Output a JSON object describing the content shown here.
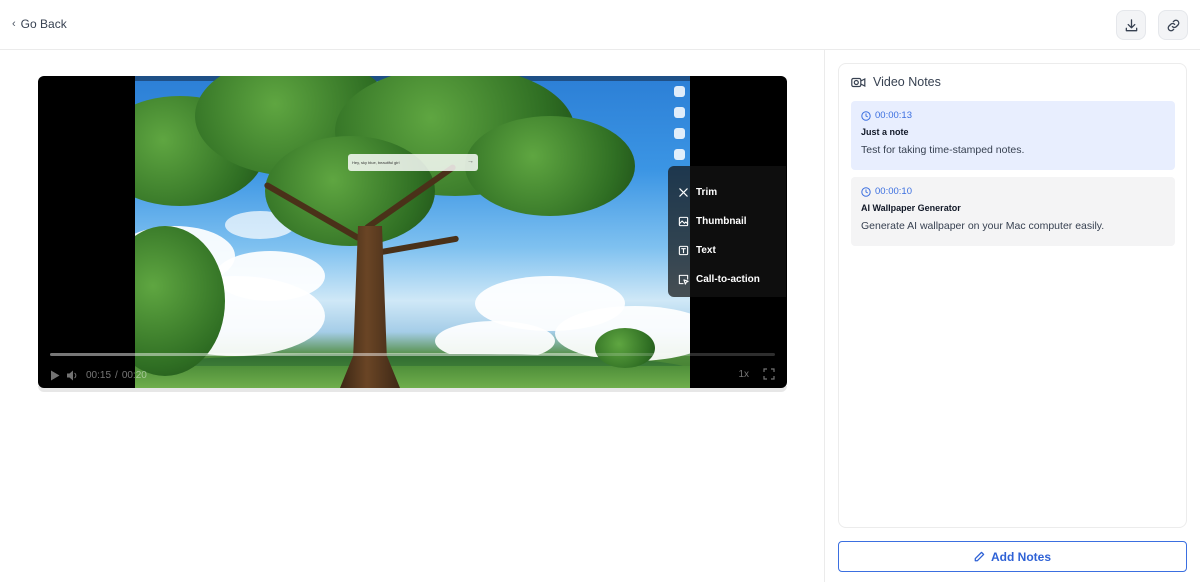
{
  "header": {
    "back_label": "Go Back",
    "back_icon": "chevron-left-icon",
    "download_icon": "download-icon",
    "link_icon": "link-icon"
  },
  "player": {
    "prompt_text": "Hey, sky blue, beautiful girl",
    "tools": [
      {
        "label": "Trim",
        "icon": "scissors-icon"
      },
      {
        "label": "Thumbnail",
        "icon": "image-icon"
      },
      {
        "label": "Text",
        "icon": "text-icon"
      },
      {
        "label": "Call-to-action",
        "icon": "cursor-icon"
      }
    ],
    "current_time": "00:15",
    "separator": "/",
    "duration": "00:20",
    "progress_fraction": 0.75,
    "speed": "1x"
  },
  "notes": {
    "title": "Video Notes",
    "items": [
      {
        "time": "00:00:13",
        "title": "Just a note",
        "body": "Test for taking time-stamped notes."
      },
      {
        "time": "00:00:10",
        "title": "AI Wallpaper Generator",
        "body": "Generate AI wallpaper on your Mac computer easily."
      }
    ],
    "add_label": "Add Notes"
  },
  "colors": {
    "accent": "#3b6fe0",
    "active_note_bg": "#e8eefe",
    "note_bg": "#f4f4f5"
  }
}
